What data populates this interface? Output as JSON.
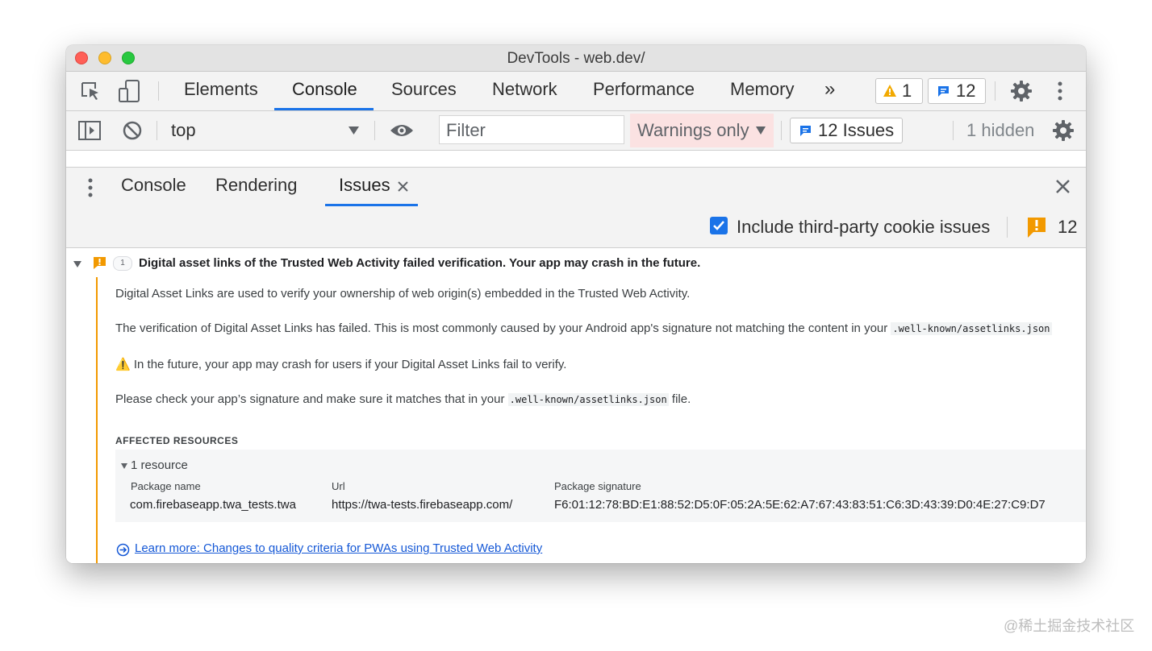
{
  "window": {
    "title": "DevTools - web.dev/"
  },
  "main_tabs": [
    {
      "label": "Elements"
    },
    {
      "label": "Console"
    },
    {
      "label": "Sources"
    },
    {
      "label": "Network"
    },
    {
      "label": "Performance"
    },
    {
      "label": "Memory"
    }
  ],
  "counters": {
    "warnings": "1",
    "messages": "12"
  },
  "console_toolbar": {
    "context": "top",
    "filter_placeholder": "Filter",
    "levels": "Warnings only",
    "issues_button": "12 Issues",
    "hidden": "1 hidden"
  },
  "drawer": {
    "tabs": [
      {
        "label": "Console"
      },
      {
        "label": "Rendering"
      },
      {
        "label": "Issues"
      }
    ]
  },
  "issues_panel": {
    "include_third_party_label": "Include third-party cookie issues",
    "include_third_party_checked": true,
    "issue_count": "12"
  },
  "issue": {
    "occurrences": "1",
    "title": "Digital asset links of the Trusted Web Activity failed verification. Your app may crash in the future.",
    "p1": "Digital Asset Links are used to verify your ownership of web origin(s) embedded in the Trusted Web Activity.",
    "p2_text": "The verification of Digital Asset Links has failed. This is most commonly caused by your Android app's signature not matching the content in your",
    "p2_code": ".well-known/assetlinks.json",
    "p3_icon": "⚠️",
    "p3_text": "In the future, your app may crash for users if your Digital Asset Links fail to verify.",
    "p4_text": "Please check your app’s signature and make sure it matches that in your",
    "p4_code": ".well-known/assetlinks.json",
    "p4_suffix": "file.",
    "affected_heading": "AFFECTED RESOURCES",
    "resource_toggle": "1 resource",
    "table": {
      "headers": [
        "Package name",
        "Url",
        "Package signature"
      ],
      "row": [
        "com.firebaseapp.twa_tests.twa",
        "https://twa-tests.firebaseapp.com/",
        "F6:01:12:78:BD:E1:88:52:D5:0F:05:2A:5E:62:A7:67:43:83:51:C6:3D:43:39:D0:4E:27:C9:D7"
      ]
    },
    "learn_more": "Learn more: Changes to quality criteria for PWAs using Trusted Web Activity"
  },
  "watermark": "@稀土掘金技术社区",
  "colors": {
    "accent": "#1a73e8",
    "warning": "#f29900",
    "link": "#1558d6"
  }
}
